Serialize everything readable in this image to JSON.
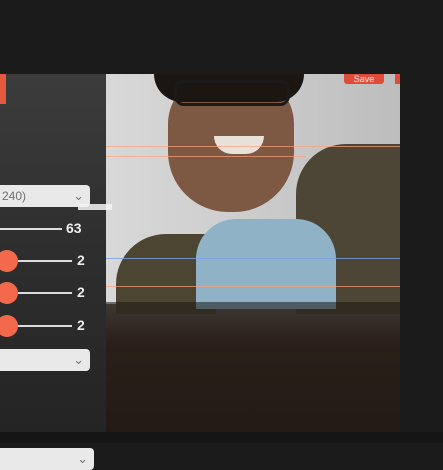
{
  "panel": {
    "select_1_text": "240)",
    "select_2_text": "",
    "select_3_text": "",
    "chevron": "⌄",
    "sliders": [
      {
        "value": "63"
      },
      {
        "value": "2"
      },
      {
        "value": "2"
      },
      {
        "value": "2"
      }
    ]
  },
  "video": {
    "badge": "Save"
  },
  "colors": {
    "accent": "#f2694c",
    "badge": "#e14b3a",
    "background": "#1b1b1b"
  }
}
